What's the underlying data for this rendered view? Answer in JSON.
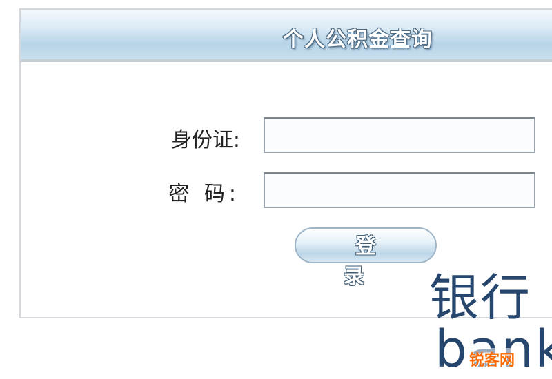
{
  "header": {
    "title": "个人公积金查询"
  },
  "form": {
    "id_label": "身份证:",
    "id_value": "",
    "password_label": "密 码:",
    "password_value": "",
    "login_label": "登 录"
  },
  "watermark": {
    "line1": "银行",
    "line2": "bank"
  },
  "site_badge": {
    "text": "锐客网"
  },
  "colors": {
    "header_gradient": "#b7d4e8",
    "watermark": "#27466e",
    "badge": "#ff6a00"
  }
}
